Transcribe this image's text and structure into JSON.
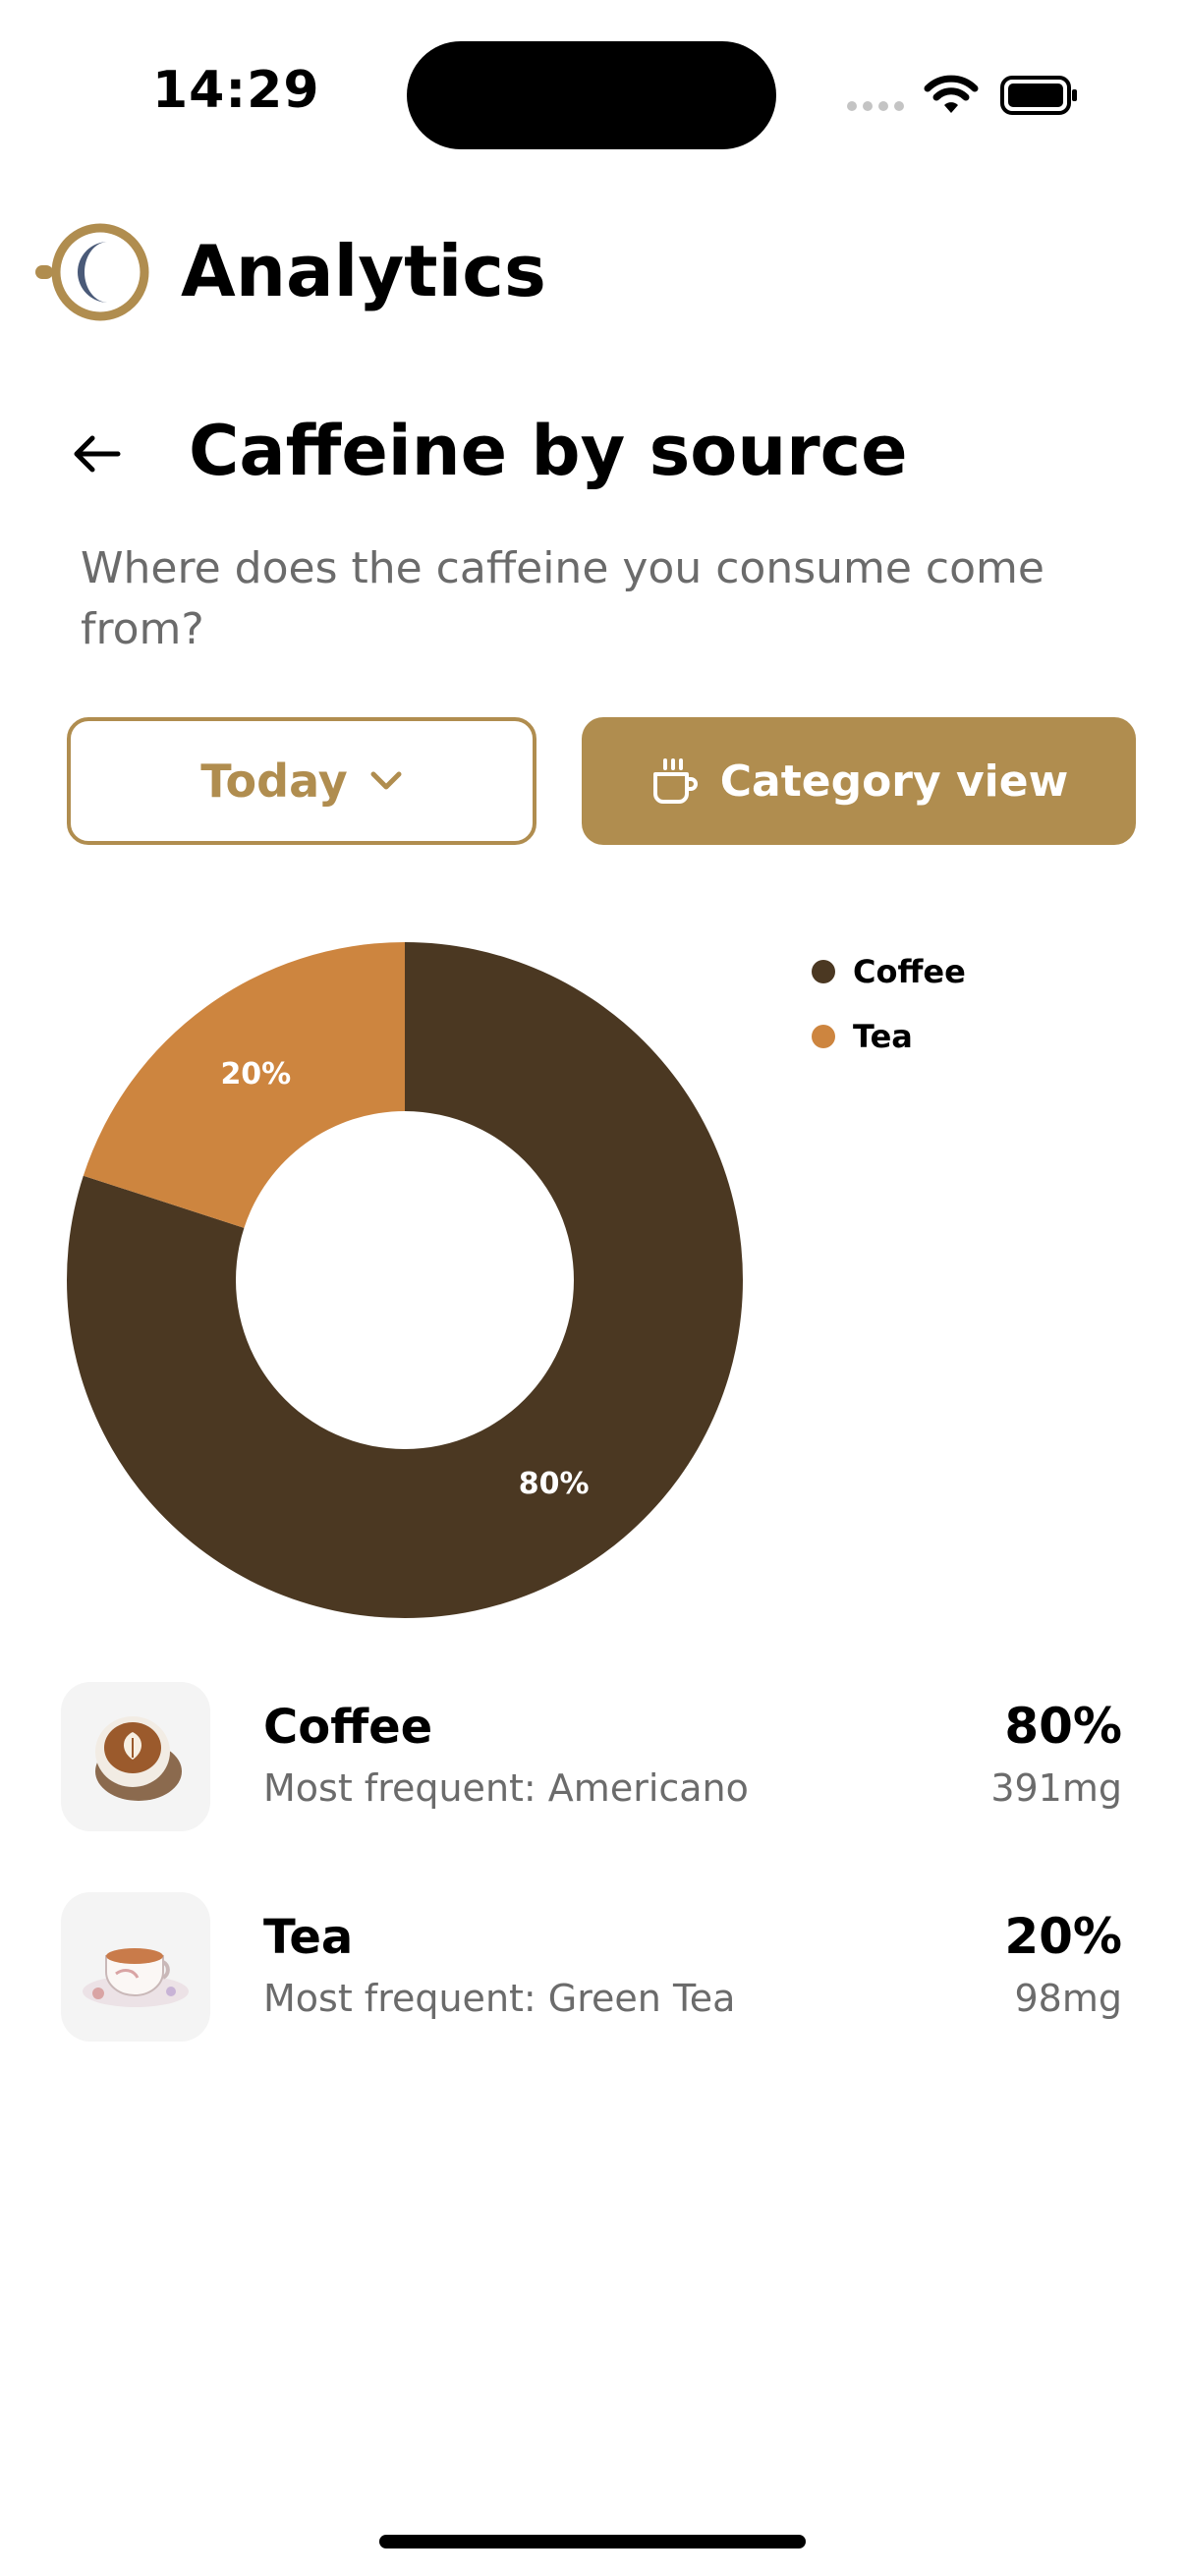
{
  "status_bar": {
    "time": "14:29"
  },
  "header": {
    "app_title": "Analytics",
    "logo_icon": "moon-cup-icon"
  },
  "page": {
    "title": "Caffeine by source",
    "subtitle": "Where does the caffeine you consume come from?"
  },
  "controls": {
    "period_label": "Today",
    "view_label": "Category view"
  },
  "colors": {
    "accent": "#b08d4f",
    "coffee": "#4b3822",
    "tea": "#cd853f",
    "logo_moon": "#4a5a78"
  },
  "chart_data": {
    "type": "pie",
    "donut": true,
    "categories": [
      "Coffee",
      "Tea"
    ],
    "values": [
      80,
      20
    ],
    "labels": [
      "80%",
      "20%"
    ],
    "colors": [
      "#4b3822",
      "#cd853f"
    ],
    "legend": "top-right"
  },
  "sources": [
    {
      "name": "Coffee",
      "subtitle": "Most frequent: Americano",
      "percent": "80%",
      "amount": "391mg",
      "icon": "latte-cup-icon"
    },
    {
      "name": "Tea",
      "subtitle": "Most frequent: Green Tea",
      "percent": "20%",
      "amount": "98mg",
      "icon": "teacup-icon"
    }
  ]
}
